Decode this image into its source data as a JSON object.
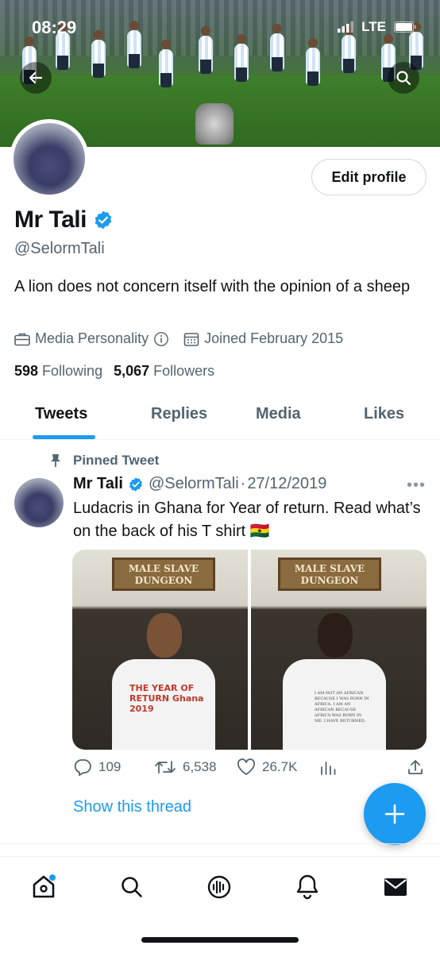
{
  "status_bar": {
    "time": "08:29",
    "network": "LTE"
  },
  "profile": {
    "name": "Mr Tali",
    "handle": "@SelormTali",
    "bio": "A lion does not concern itself with the opinion of a sheep",
    "category": "Media Personality",
    "joined": "Joined February 2015",
    "following_count": "598",
    "following_label": "Following",
    "followers_count": "5,067",
    "followers_label": "Followers",
    "edit_label": "Edit profile"
  },
  "tabs": [
    {
      "label": "Tweets",
      "active": true
    },
    {
      "label": "Replies",
      "active": false
    },
    {
      "label": "Media",
      "active": false
    },
    {
      "label": "Likes",
      "active": false
    }
  ],
  "tweet": {
    "pinned_label": "Pinned Tweet",
    "author": "Mr Tali",
    "handle": "@SelormTali",
    "separator": "·",
    "date": "27/12/2019",
    "text": "Ludacris in Ghana for Year of return. Read what’s on the back of his T shirt 🇬🇭",
    "media": {
      "sign_text": "MALE SLAVE DUNGEON",
      "shirt_front_text": "THE YEAR OF RETURN Ghana 2019",
      "shirt_back_text": "I AM NOT AN AFRICAN BECAUSE I WAS BORN IN AFRICA. I AM AN AFRICAN BECAUSE AFRICA WAS BORN IN ME. I HAVE RETURNED."
    },
    "replies": "109",
    "retweets": "6,538",
    "likes": "26.7K",
    "show_thread": "Show this thread"
  },
  "colors": {
    "accent": "#1d9bf0",
    "text": "#0f1419",
    "muted": "#536471"
  },
  "icons": {
    "back": "arrow-left-icon",
    "search": "search-icon",
    "verified": "verified-badge-icon",
    "briefcase": "briefcase-icon",
    "info": "info-icon",
    "calendar": "calendar-icon",
    "pin": "pin-icon",
    "more": "more-icon",
    "reply": "reply-icon",
    "retweet": "retweet-icon",
    "like": "heart-icon",
    "analytics": "analytics-icon",
    "share": "share-icon",
    "compose": "plus-icon",
    "home": "home-icon",
    "explore": "search-icon",
    "spaces": "spaces-icon",
    "notifications": "bell-icon",
    "messages": "mail-icon"
  }
}
